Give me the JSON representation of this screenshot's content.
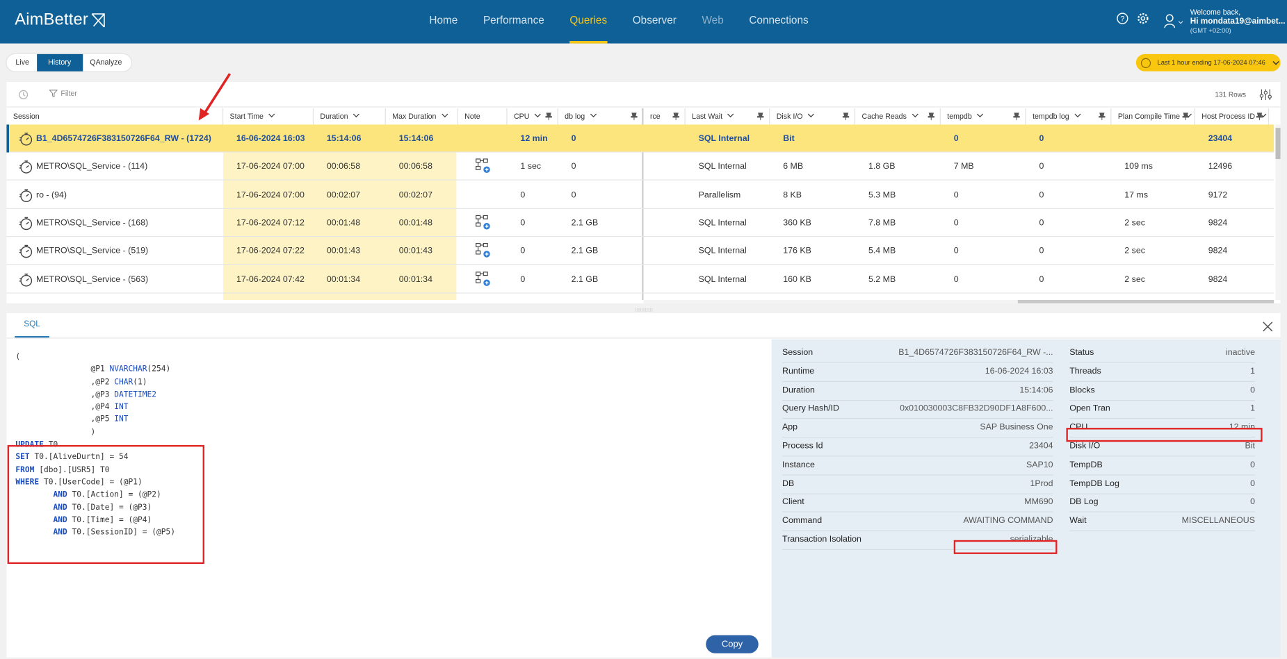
{
  "app": {
    "logo": "AimBetter",
    "nav": [
      "Home",
      "Performance",
      "Queries",
      "Observer",
      "Web",
      "Connections"
    ],
    "nav_active": "Queries",
    "welcome_line": "Welcome back,",
    "user": "Hi mondata19@aimbet...",
    "timezone": "(GMT +02:00)"
  },
  "tabs": [
    "Live",
    "History",
    "QAnalyze"
  ],
  "active_tab": "History",
  "time_range": "Last 1 hour ending  17-06-2024 07:46",
  "grid": {
    "filter_label": "Filter",
    "rows_count": "131 Rows",
    "columns": [
      "Session",
      "Start Time",
      "Duration",
      "Max Duration",
      "Note",
      "CPU",
      "db log",
      "rce",
      "Last Wait",
      "Disk I/O",
      "Cache Reads",
      "tempdb",
      "tempdb log",
      "Plan Compile Time",
      "Host Process ID"
    ],
    "rows": [
      {
        "session": "B1_4D6574726F383150726F64_RW - (1724)",
        "start": "16-06-2024 16:03",
        "duration": "15:14:06",
        "max": "15:14:06",
        "note": false,
        "cpu": "12 min",
        "dblog": "0",
        "wait": "SQL Internal",
        "disk": "Bit",
        "cache": "",
        "tempdb": "0",
        "tempdblog": "0",
        "plan": "",
        "host": "23404",
        "selected": true
      },
      {
        "session": "METRO\\SQL_Service - (114)",
        "start": "17-06-2024 07:00",
        "duration": "00:06:58",
        "max": "00:06:58",
        "note": true,
        "cpu": "1 sec",
        "dblog": "0",
        "wait": "SQL Internal",
        "disk": "6 MB",
        "cache": "1.8 GB",
        "tempdb": "7 MB",
        "tempdblog": "0",
        "plan": "109 ms",
        "host": "12496",
        "selected": false
      },
      {
        "session": "ro - (94)",
        "start": "17-06-2024 07:00",
        "duration": "00:02:07",
        "max": "00:02:07",
        "note": false,
        "cpu": "0",
        "dblog": "0",
        "wait": "Parallelism",
        "disk": "8 KB",
        "cache": "5.3 MB",
        "tempdb": "0",
        "tempdblog": "0",
        "plan": "17 ms",
        "host": "9172",
        "selected": false
      },
      {
        "session": "METRO\\SQL_Service - (168)",
        "start": "17-06-2024 07:12",
        "duration": "00:01:48",
        "max": "00:01:48",
        "note": true,
        "cpu": "0",
        "dblog": "2.1 GB",
        "wait": "SQL Internal",
        "disk": "360 KB",
        "cache": "7.8 MB",
        "tempdb": "0",
        "tempdblog": "0",
        "plan": "2 sec",
        "host": "9824",
        "selected": false
      },
      {
        "session": "METRO\\SQL_Service - (519)",
        "start": "17-06-2024 07:22",
        "duration": "00:01:43",
        "max": "00:01:43",
        "note": true,
        "cpu": "0",
        "dblog": "2.1 GB",
        "wait": "SQL Internal",
        "disk": "176 KB",
        "cache": "5.4 MB",
        "tempdb": "0",
        "tempdblog": "0",
        "plan": "2 sec",
        "host": "9824",
        "selected": false
      },
      {
        "session": "METRO\\SQL_Service - (563)",
        "start": "17-06-2024 07:42",
        "duration": "00:01:34",
        "max": "00:01:34",
        "note": true,
        "cpu": "0",
        "dblog": "2.1 GB",
        "wait": "SQL Internal",
        "disk": "160 KB",
        "cache": "5.2 MB",
        "tempdb": "0",
        "tempdblog": "0",
        "plan": "2 sec",
        "host": "9824",
        "selected": false
      }
    ]
  },
  "detail": {
    "tab": "SQL",
    "copy_label": "Copy",
    "code_params": [
      "(",
      "@P1 NVARCHAR(254)",
      ",@P2 CHAR(1)",
      ",@P3 DATETIME2",
      ",@P4 INT",
      ",@P5 INT",
      ")"
    ],
    "code_update": [
      "UPDATE T0",
      "SET T0.[AliveDurtn] = 54",
      "FROM [dbo].[USR5] T0",
      "WHERE T0.[UserCode] = (@P1)",
      "AND T0.[Action] = (@P2)",
      "AND T0.[Date] = (@P3)",
      "AND T0.[Time] = (@P4)",
      "AND T0.[SessionID] = (@P5)"
    ],
    "left": [
      {
        "k": "Session",
        "v": "B1_4D6574726F383150726F64_RW -..."
      },
      {
        "k": "Runtime",
        "v": "16-06-2024 16:03"
      },
      {
        "k": "Duration",
        "v": "15:14:06"
      },
      {
        "k": "Query Hash/ID",
        "v": "0x010030003C8FB32D90DF1A8F600..."
      },
      {
        "k": "App",
        "v": "SAP Business One"
      },
      {
        "k": "Process Id",
        "v": "23404"
      },
      {
        "k": "Instance",
        "v": "SAP10"
      },
      {
        "k": "DB",
        "v": "1Prod"
      },
      {
        "k": "Client",
        "v": "MM690"
      },
      {
        "k": "Command",
        "v": "AWAITING COMMAND"
      },
      {
        "k": "Transaction Isolation",
        "v": "serializable"
      }
    ],
    "right": [
      {
        "k": "Status",
        "v": "inactive"
      },
      {
        "k": "Threads",
        "v": "1"
      },
      {
        "k": "Blocks",
        "v": "0"
      },
      {
        "k": "Open Tran",
        "v": "1"
      },
      {
        "k": "CPU",
        "v": "12 min"
      },
      {
        "k": "Disk I/O",
        "v": "Bit"
      },
      {
        "k": "TempDB",
        "v": "0"
      },
      {
        "k": "TempDB Log",
        "v": "0"
      },
      {
        "k": "DB Log",
        "v": "0"
      },
      {
        "k": "Wait",
        "v": "MISCELLANEOUS"
      }
    ]
  },
  "colors": {
    "brand": "#0e6096",
    "accent": "#f5c518",
    "highlight": "#fde57d",
    "annotation": "#e02424"
  }
}
